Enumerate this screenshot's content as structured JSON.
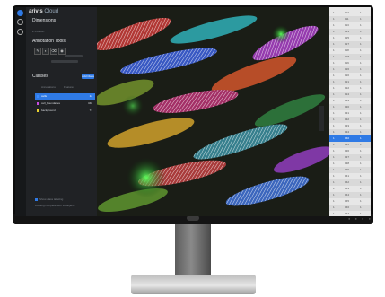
{
  "app": {
    "brand_bold": "arivis",
    "brand_light": "Cloud"
  },
  "sidebar": {
    "dimensions_title": "Dimensions",
    "dimensions_sub": "Z Position",
    "annotation_title": "Annotation Tools",
    "classes_title": "Classes",
    "add_label": "Add Class",
    "filter_a": "Annotations",
    "filter_b": "Features",
    "classes": [
      {
        "label": "cells",
        "count": "12",
        "color": "#3a8bff",
        "selected": true
      },
      {
        "label": "cell_boundaries",
        "count": "348",
        "color": "#c64de0",
        "selected": false
      },
      {
        "label": "background",
        "count": "71",
        "color": "#e8d230",
        "selected": false
      }
    ],
    "footer_check_label": "Show class labeling",
    "footer_text": "Loading complete with 18 objects"
  },
  "table": {
    "rows": [
      {
        "c1": "1",
        "c2": "117",
        "c3": "1"
      },
      {
        "c1": "1",
        "c2": "111",
        "c3": "1"
      },
      {
        "c1": "1",
        "c2": "113",
        "c3": "1"
      },
      {
        "c1": "1",
        "c2": "123",
        "c3": "1"
      },
      {
        "c1": "1",
        "c2": "125",
        "c3": "1"
      },
      {
        "c1": "1",
        "c2": "127",
        "c3": "1"
      },
      {
        "c1": "1",
        "c2": "118",
        "c3": "1"
      },
      {
        "c1": "1",
        "c2": "128",
        "c3": "1"
      },
      {
        "c1": "1",
        "c2": "119",
        "c3": "1"
      },
      {
        "c1": "1",
        "c2": "126",
        "c3": "1"
      },
      {
        "c1": "1",
        "c2": "120",
        "c3": "1"
      },
      {
        "c1": "1",
        "c2": "121",
        "c3": "1"
      },
      {
        "c1": "1",
        "c2": "122",
        "c3": "1"
      },
      {
        "c1": "1",
        "c2": "124",
        "c3": "1"
      },
      {
        "c1": "1",
        "c2": "129",
        "c3": "1"
      },
      {
        "c1": "1",
        "c2": "130",
        "c3": "1"
      },
      {
        "c1": "1",
        "c2": "131",
        "c3": "1"
      },
      {
        "c1": "1",
        "c2": "132",
        "c3": "1"
      },
      {
        "c1": "1",
        "c2": "133",
        "c3": "1"
      },
      {
        "c1": "1",
        "c2": "134",
        "c3": "1"
      },
      {
        "c1": "1",
        "c2": "140",
        "c3": "1"
      },
      {
        "c1": "1",
        "c2": "135",
        "c3": "1"
      },
      {
        "c1": "1",
        "c2": "136",
        "c3": "1"
      },
      {
        "c1": "1",
        "c2": "137",
        "c3": "1"
      },
      {
        "c1": "1",
        "c2": "138",
        "c3": "1"
      },
      {
        "c1": "1",
        "c2": "139",
        "c3": "1"
      },
      {
        "c1": "1",
        "c2": "141",
        "c3": "1"
      },
      {
        "c1": "1",
        "c2": "142",
        "c3": "1"
      },
      {
        "c1": "1",
        "c2": "143",
        "c3": "1"
      },
      {
        "c1": "1",
        "c2": "144",
        "c3": "1"
      },
      {
        "c1": "1",
        "c2": "145",
        "c3": "1"
      },
      {
        "c1": "1",
        "c2": "146",
        "c3": "1"
      },
      {
        "c1": "1",
        "c2": "147",
        "c3": "1"
      }
    ],
    "selected_index": 20
  },
  "icons": [
    "layers-icon",
    "palette-icon",
    "settings-icon",
    "pen-icon",
    "brush-icon",
    "eraser-icon",
    "eye-icon",
    "zoom-in-icon",
    "zoom-out-icon"
  ],
  "colors": {
    "accent": "#2f7ae5",
    "panel": "#202225",
    "table_bg": "#e7e7e7"
  }
}
